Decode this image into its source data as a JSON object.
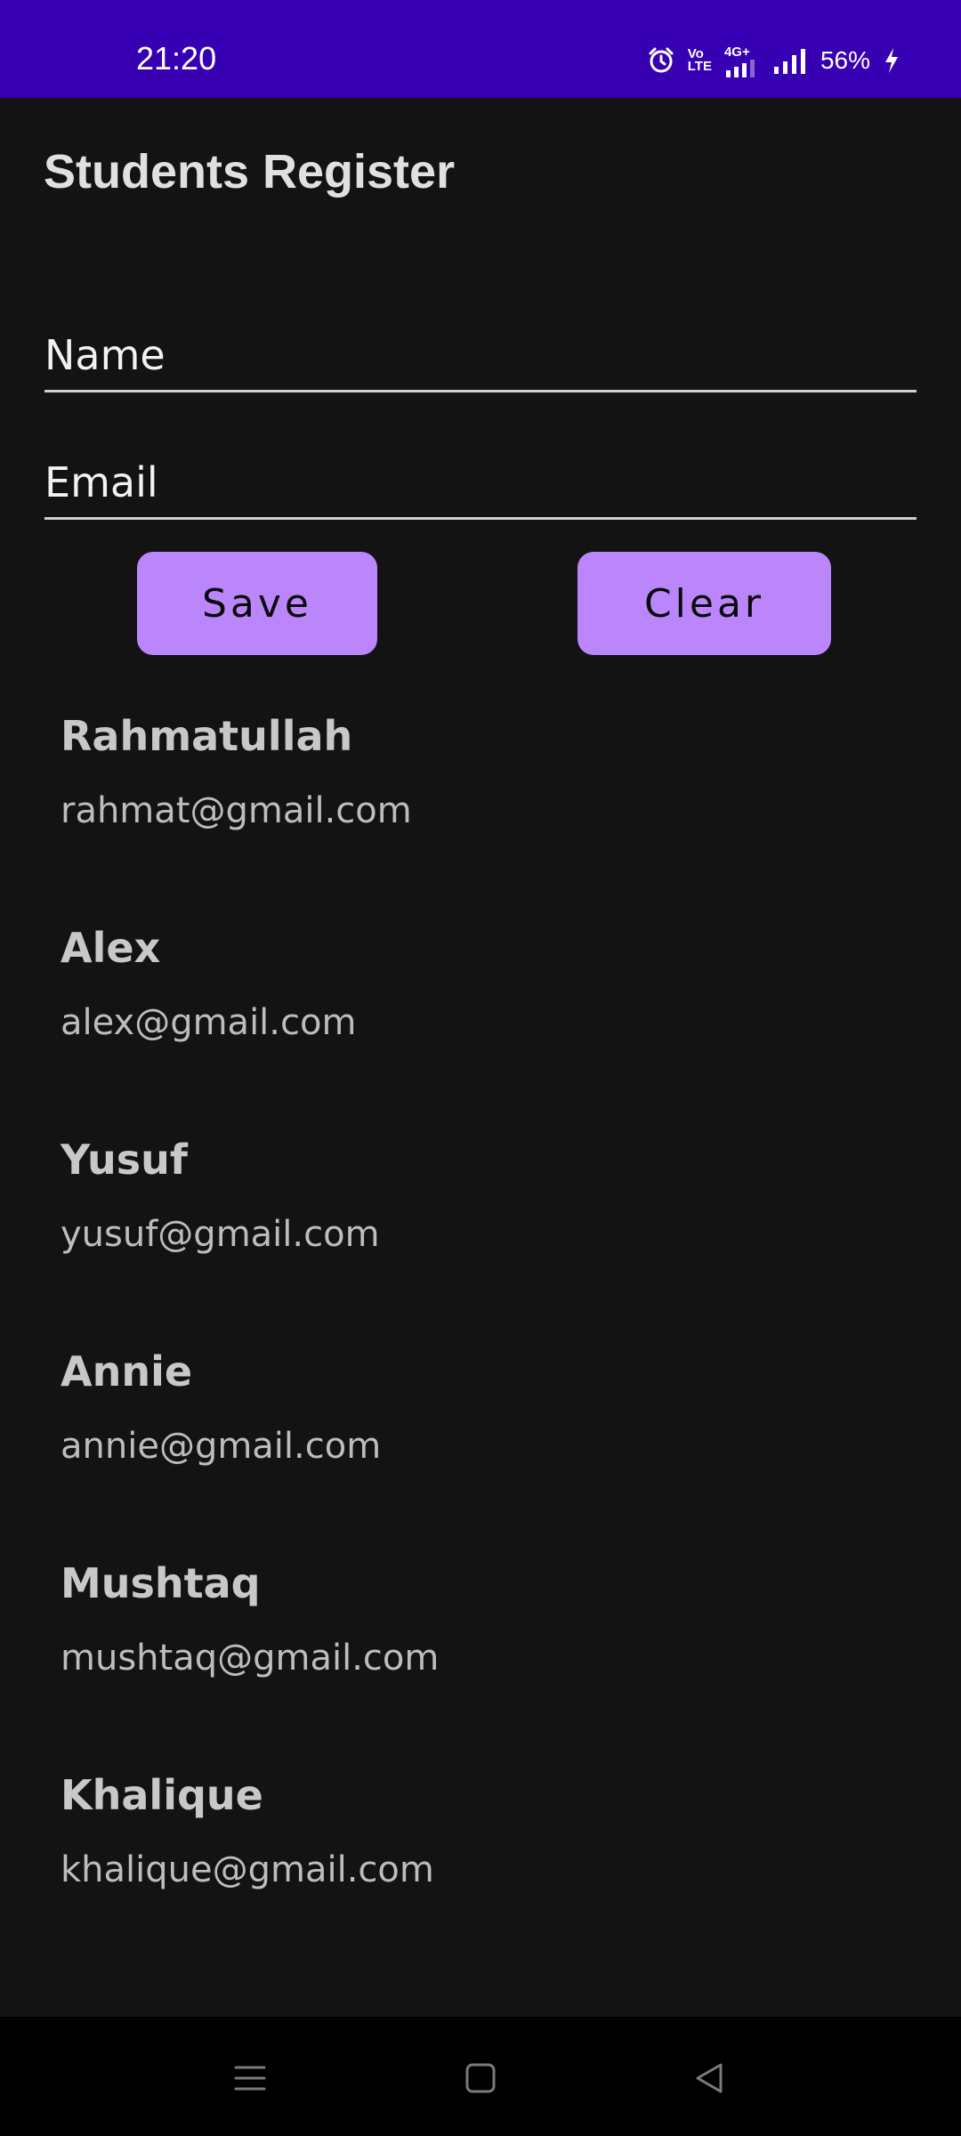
{
  "status_bar": {
    "time": "21:20",
    "volte_line1": "Vo",
    "volte_line2": "LTE",
    "network": "4G+",
    "battery": "56%",
    "icons": [
      "alarm-icon",
      "volte-icon",
      "4g-signal-icon",
      "signal-icon",
      "battery-charging-icon"
    ]
  },
  "app": {
    "title": "Students Register"
  },
  "form": {
    "name_placeholder": "Name",
    "email_placeholder": "Email",
    "name_value": "",
    "email_value": ""
  },
  "buttons": {
    "save_label": "Save",
    "clear_label": "Clear"
  },
  "students": [
    {
      "name": "Rahmatullah",
      "email": "rahmat@gmail.com"
    },
    {
      "name": "Alex",
      "email": "alex@gmail.com"
    },
    {
      "name": "Yusuf",
      "email": "yusuf@gmail.com"
    },
    {
      "name": "Annie",
      "email": "annie@gmail.com"
    },
    {
      "name": "Mushtaq",
      "email": "mushtaq@gmail.com"
    },
    {
      "name": "Khalique",
      "email": "khalique@gmail.com"
    }
  ],
  "nav_bar": {
    "icons": [
      "menu-icon",
      "home-square-icon",
      "back-triangle-icon"
    ]
  },
  "colors": {
    "status_bar": "#3700b3",
    "background": "#131313",
    "button": "#bb86fc",
    "nav_bar": "#000000"
  }
}
